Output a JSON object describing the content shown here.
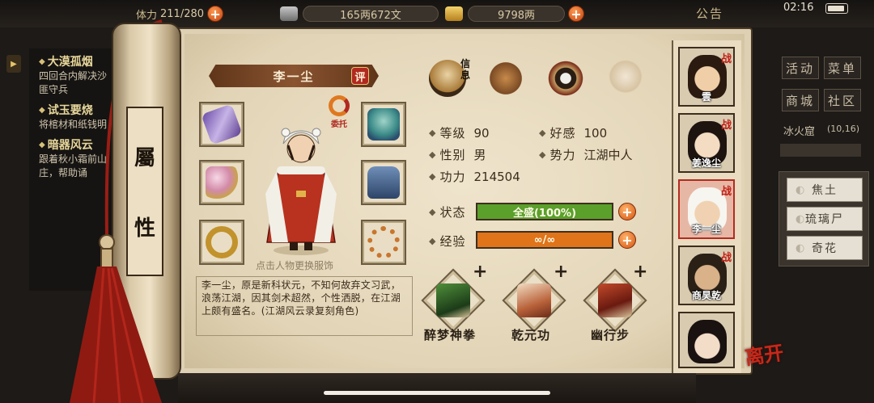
{
  "status_bar": {
    "stamina_label": "体力",
    "stamina": "211/280",
    "silver": "165两672文",
    "gold": "9798两",
    "notice": "公告",
    "time": "02:16"
  },
  "quests": [
    {
      "title": "大漠孤烟",
      "desc": "四回合内解决沙匪守兵"
    },
    {
      "title": "试玉要烧",
      "desc": "将棺材和纸钱明"
    },
    {
      "title": "暗器风云",
      "desc": "跟着秋小霜前山庄，帮助诵"
    }
  ],
  "roller": {
    "label_top": "屬",
    "label_bottom": "性"
  },
  "character": {
    "name": "李一尘",
    "rate_label": "评",
    "entrust_label": "委托",
    "hint": "点击人物更换服饰",
    "description": "李一尘，原是新科状元，不知何故弃文习武，浪荡江湖，因其剑术超然，个性洒脱，在江湖上颇有盛名。(江湖风云录复刻角色)"
  },
  "tabs": {
    "info_label": "信息"
  },
  "stats": {
    "level_label": "等级",
    "level": "90",
    "affinity_label": "好感",
    "affinity": "100",
    "gender_label": "性别",
    "gender": "男",
    "faction_label": "势力",
    "faction": "江湖中人",
    "power_label": "功力",
    "power": "214504",
    "state_label": "状态",
    "state": "全盛(100%)",
    "state_fill": 1.0,
    "exp_label": "经验",
    "exp": "∞/∞",
    "exp_fill": 1.0
  },
  "skills": [
    {
      "name": "醉梦神拳",
      "plus": "+"
    },
    {
      "name": "乾元功",
      "plus": "+"
    },
    {
      "name": "幽行步",
      "plus": "+"
    }
  ],
  "roster": [
    {
      "name": "雲",
      "badge": "战"
    },
    {
      "name": "姜逸尘",
      "badge": "战"
    },
    {
      "name": "李一尘",
      "badge": "战"
    },
    {
      "name": "商昊乾",
      "badge": "战"
    }
  ],
  "right_menu": {
    "activity": "活动",
    "menu": "菜单",
    "shop": "商城",
    "community": "社区",
    "location": "冰火窟",
    "coords": "(10,16)",
    "sub_items": [
      "焦土",
      "琉璃尸",
      "奇花"
    ]
  },
  "leave": "离开",
  "colors": {
    "state_bar": "#5aa02a",
    "exp_bar": "#e0741a",
    "accent_red": "#b02a1f"
  }
}
